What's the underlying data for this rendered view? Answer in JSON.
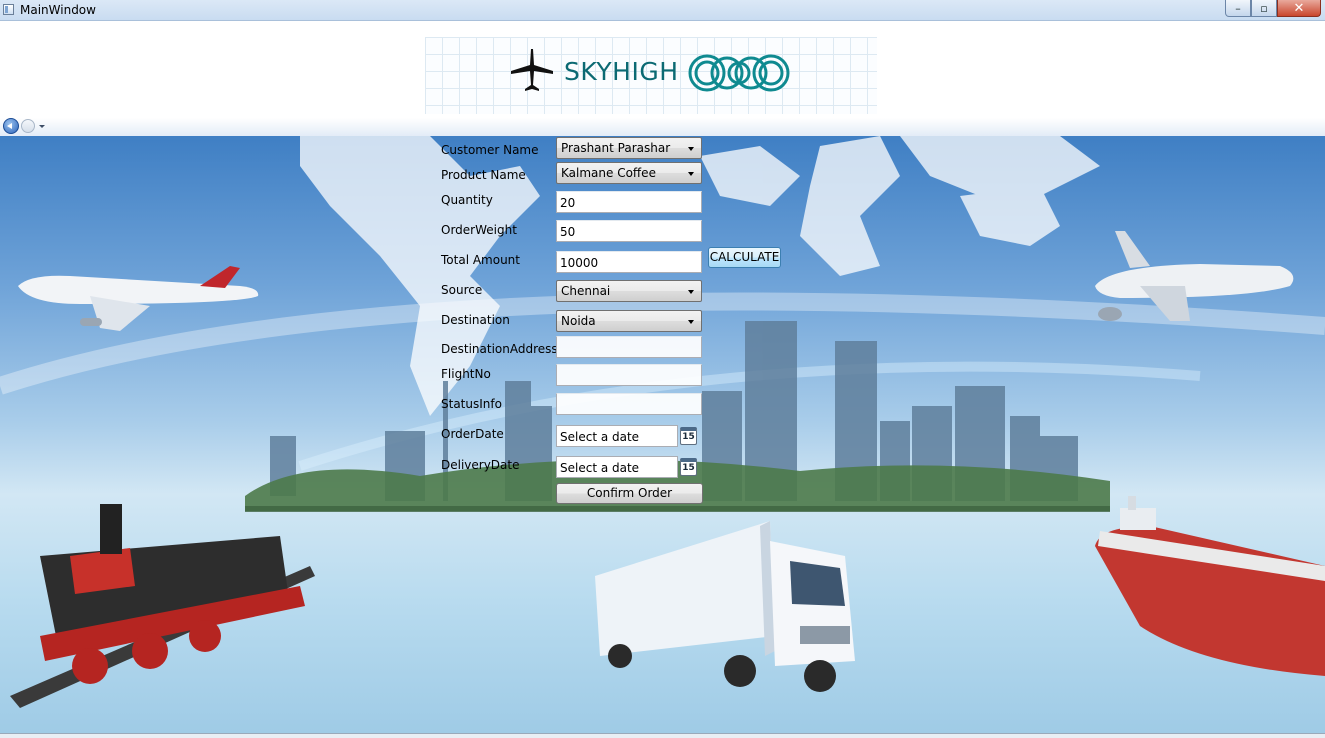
{
  "window": {
    "title": "MainWindow",
    "controls": {
      "minimize": "–",
      "maximize": "▫",
      "close": "✕"
    }
  },
  "brand": {
    "name": "SKYHIGH"
  },
  "nav": {
    "back": "back-arrow-icon",
    "forward": "forward-arrow-icon"
  },
  "form": {
    "customer_name": {
      "label": "Customer Name",
      "value": "Prashant Parashar"
    },
    "product_name": {
      "label": "Product Name",
      "value": "Kalmane Coffee"
    },
    "quantity": {
      "label": "Quantity",
      "value": "20"
    },
    "order_weight": {
      "label": "OrderWeight",
      "value": "50"
    },
    "total_amount": {
      "label": "Total Amount",
      "value": "10000"
    },
    "calculate_label": "CALCULATE",
    "source": {
      "label": "Source",
      "value": "Chennai"
    },
    "destination": {
      "label": "Destination",
      "value": "Noida"
    },
    "destination_address": {
      "label": "DestinationAddress",
      "value": ""
    },
    "flight_no": {
      "label": "FlightNo",
      "value": ""
    },
    "status_info": {
      "label": "StatusInfo",
      "value": ""
    },
    "order_date": {
      "label": "OrderDate",
      "value": "Select a date",
      "calendar_day": "15"
    },
    "delivery_date": {
      "label": "DeliveryDate",
      "value": "Select a date",
      "calendar_day": "15"
    },
    "confirm_label": "Confirm Order"
  },
  "colors": {
    "brand_teal": "#0c6a73",
    "sky": "#3f7fc4",
    "water": "#b8dbef"
  }
}
